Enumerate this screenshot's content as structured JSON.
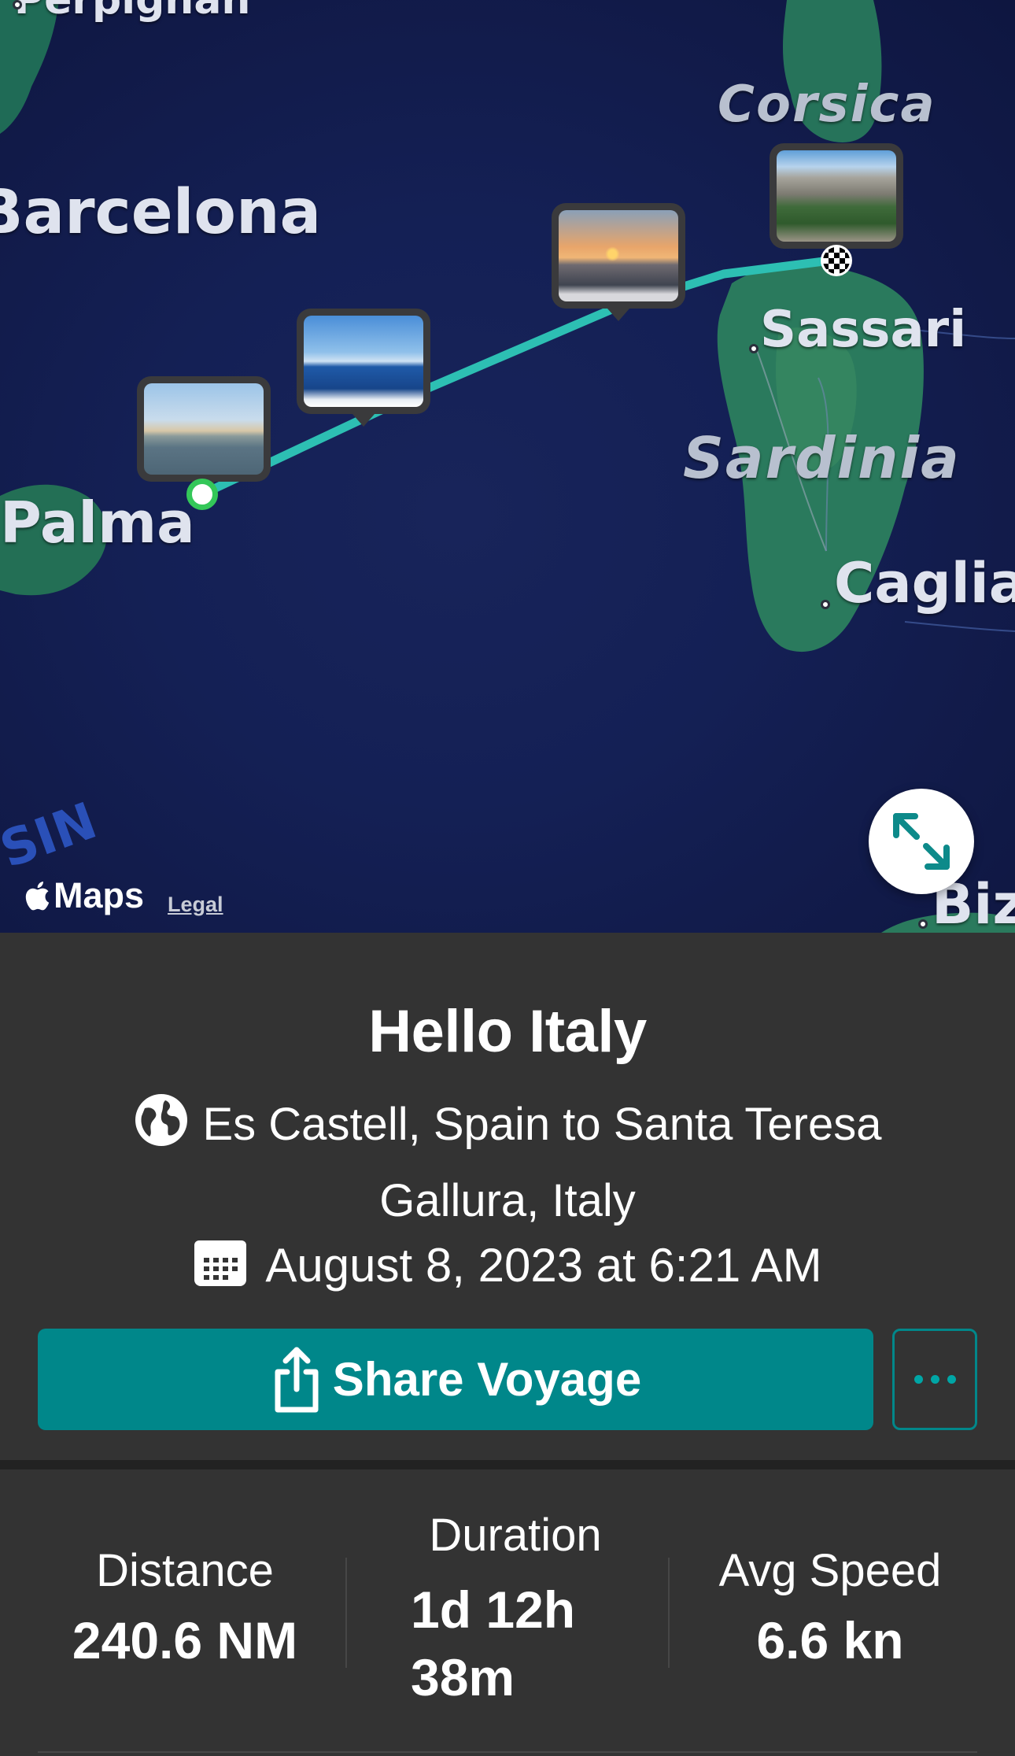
{
  "map": {
    "labels": {
      "perpignan": "Perpignan",
      "barcelona": "Barcelona",
      "palma": "Palma",
      "corsica": "Corsica",
      "sassari": "Sassari",
      "sardinia": "Sardinia",
      "cagliari": "Caglia",
      "bizerte": "Biz",
      "basin": "SIN"
    },
    "route_color": "#2dbfb3",
    "attribution": {
      "brand": "Maps",
      "legal": "Legal"
    },
    "expand_icon": "expand-arrows-icon"
  },
  "voyage": {
    "title": "Hello Italy",
    "route": "Es Castell, Spain to Santa Teresa Gallura, Italy",
    "date": "August 8, 2023 at 6:21 AM",
    "share_label": "Share Voyage",
    "accent_color": "#00878a"
  },
  "stats": {
    "distance": {
      "label": "Distance",
      "value": "240.6 NM"
    },
    "duration": {
      "label": "Duration",
      "value_line1": "1d 12h",
      "value_line2": "38m"
    },
    "avg_speed": {
      "label": "Avg Speed",
      "value": "6.6 kn"
    }
  }
}
